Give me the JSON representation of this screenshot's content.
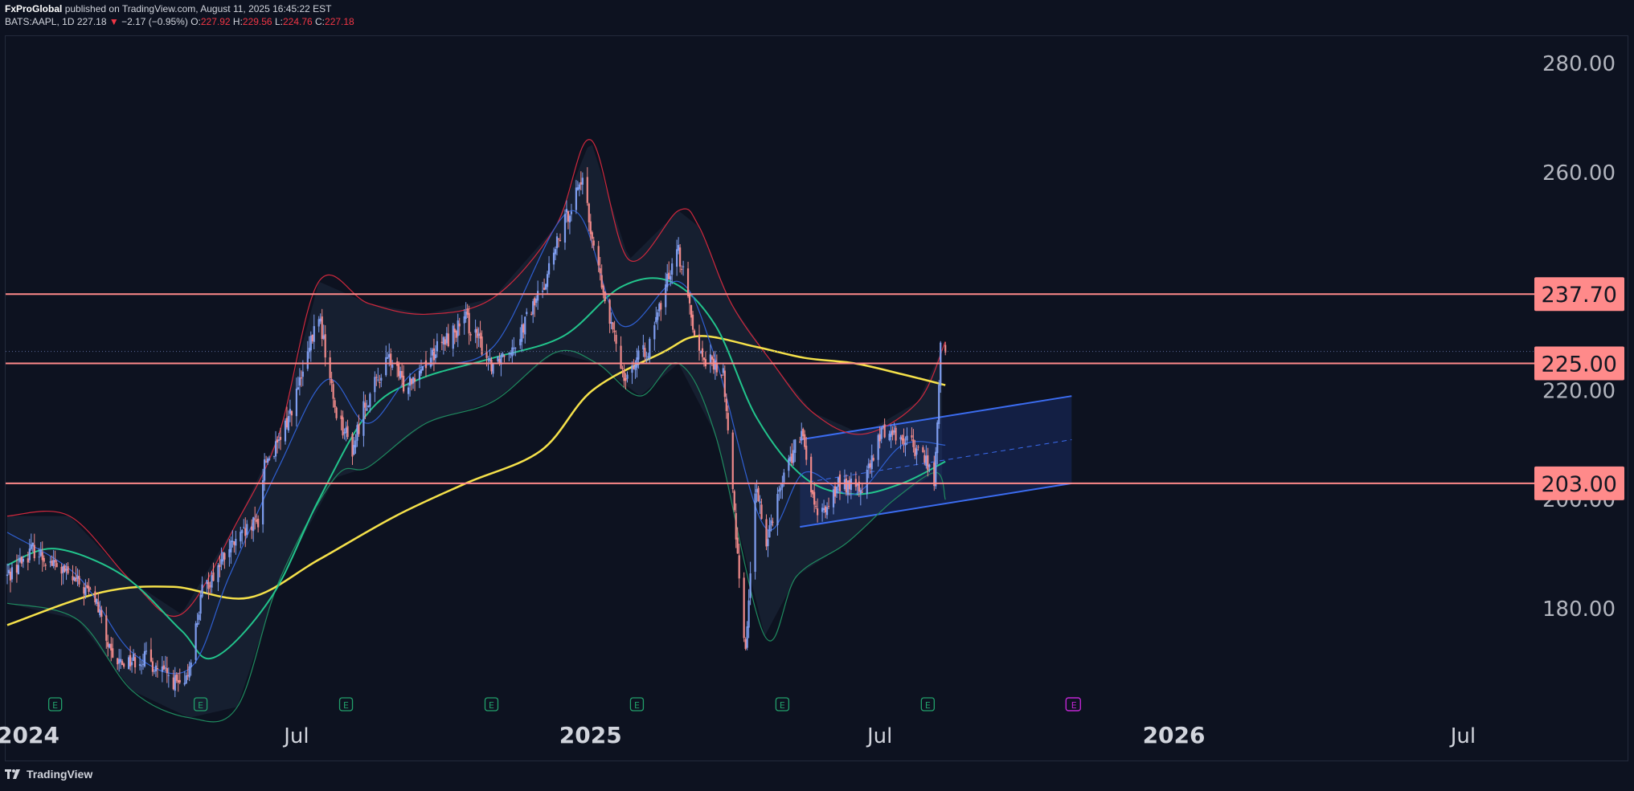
{
  "header": {
    "publisher": "FxProGlobal",
    "published_text": "published on TradingView.com, August 11, 2025 16:45:22 EST",
    "symbol": "BATS:AAPL, 1D",
    "last": "227.18",
    "change": "−2.17 (−0.95%)",
    "o_label": "O:",
    "o": "227.92",
    "h_label": "H:",
    "h": "229.56",
    "l_label": "L:",
    "l": "224.76",
    "c_label": "C:",
    "c": "227.18"
  },
  "footer": {
    "brand": "TradingView"
  },
  "colors": {
    "background": "#0d1220",
    "up_candle": "#7f9ef0",
    "down_candle": "#f08a8a",
    "level_line": "#ff8a8a",
    "level_label_bg": "#ff8a8a",
    "ma200": "#f5e14a",
    "ma50": "#22c48c",
    "ma20": "#2f5fd1",
    "bb_band": "#d0283d",
    "bb_lower": "#1f8a5f",
    "channel": "#3b6cf0",
    "earnings": "#22a06b",
    "future_earnings": "#c026d3"
  },
  "chart_data": {
    "type": "candlestick",
    "symbol": "BATS:AAPL",
    "timeframe": "1D",
    "ylim": [
      158,
      286
    ],
    "x_range": [
      "2024-01-01",
      "2026-08-10"
    ],
    "price_axis_ticks": [
      "280.00",
      "260.00",
      "220.00",
      "200.00",
      "180.00"
    ],
    "price_axis_tick_values": [
      280,
      260,
      220,
      200,
      180
    ],
    "time_axis_labels": [
      {
        "label": "2024",
        "date": "2024-01-01",
        "bold": true
      },
      {
        "label": "Jul",
        "date": "2024-07-01",
        "bold": false
      },
      {
        "label": "2025",
        "date": "2025-01-01",
        "bold": true
      },
      {
        "label": "Jul",
        "date": "2025-07-01",
        "bold": false
      },
      {
        "label": "2026",
        "date": "2026-01-01",
        "bold": true
      },
      {
        "label": "Jul",
        "date": "2026-07-01",
        "bold": false
      }
    ],
    "horizontal_levels": [
      {
        "value": 237.7,
        "label": "237.70"
      },
      {
        "value": 225.0,
        "label": "225.00"
      },
      {
        "value": 203.0,
        "label": "203.00"
      }
    ],
    "last_price": 227.18,
    "earnings_markers": [
      "2024-02-01",
      "2024-05-02",
      "2024-08-01",
      "2024-10-31",
      "2025-01-30",
      "2025-05-01",
      "2025-07-31"
    ],
    "future_earnings_marker": "2025-10-30",
    "earnings_label": "E",
    "close_anchors": [
      [
        "2024-01-02",
        186
      ],
      [
        "2024-01-18",
        191
      ],
      [
        "2024-02-05",
        187
      ],
      [
        "2024-02-26",
        182
      ],
      [
        "2024-03-08",
        170
      ],
      [
        "2024-03-28",
        171
      ],
      [
        "2024-04-18",
        166
      ],
      [
        "2024-04-22",
        165
      ],
      [
        "2024-05-03",
        183
      ],
      [
        "2024-05-20",
        191
      ],
      [
        "2024-06-07",
        196
      ],
      [
        "2024-06-11",
        207
      ],
      [
        "2024-06-20",
        210
      ],
      [
        "2024-07-05",
        223
      ],
      [
        "2024-07-15",
        234
      ],
      [
        "2024-07-25",
        217
      ],
      [
        "2024-08-05",
        209
      ],
      [
        "2024-08-12",
        217
      ],
      [
        "2024-08-28",
        226
      ],
      [
        "2024-09-06",
        221
      ],
      [
        "2024-09-25",
        227
      ],
      [
        "2024-10-15",
        233
      ],
      [
        "2024-10-31",
        225
      ],
      [
        "2024-11-15",
        229
      ],
      [
        "2024-12-02",
        239
      ],
      [
        "2024-12-16",
        251
      ],
      [
        "2024-12-26",
        259
      ],
      [
        "2025-01-10",
        236
      ],
      [
        "2025-01-22",
        223
      ],
      [
        "2025-02-07",
        228
      ],
      [
        "2025-02-24",
        247
      ],
      [
        "2025-03-10",
        227
      ],
      [
        "2025-03-25",
        223
      ],
      [
        "2025-04-08",
        172
      ],
      [
        "2025-04-14",
        202
      ],
      [
        "2025-04-21",
        193
      ],
      [
        "2025-05-02",
        205
      ],
      [
        "2025-05-13",
        212
      ],
      [
        "2025-05-23",
        196
      ],
      [
        "2025-06-06",
        203
      ],
      [
        "2025-06-20",
        202
      ],
      [
        "2025-07-03",
        213
      ],
      [
        "2025-07-18",
        211
      ],
      [
        "2025-07-31",
        207
      ],
      [
        "2025-08-04",
        203
      ],
      [
        "2025-08-06",
        213
      ],
      [
        "2025-08-08",
        229
      ],
      [
        "2025-08-11",
        227
      ]
    ],
    "moving_averages": [
      {
        "period": "200",
        "color": "#f5e14a",
        "points": [
          [
            "2024-01-02",
            177
          ],
          [
            "2024-03-01",
            183
          ],
          [
            "2024-04-15",
            184
          ],
          [
            "2024-06-01",
            182
          ],
          [
            "2024-07-15",
            189
          ],
          [
            "2024-09-01",
            197
          ],
          [
            "2024-10-15",
            203
          ],
          [
            "2024-12-01",
            209
          ],
          [
            "2025-01-02",
            220
          ],
          [
            "2025-02-15",
            227
          ],
          [
            "2025-03-10",
            230
          ],
          [
            "2025-04-15",
            228
          ],
          [
            "2025-05-15",
            226
          ],
          [
            "2025-06-15",
            225
          ],
          [
            "2025-07-15",
            223
          ],
          [
            "2025-08-11",
            221
          ]
        ]
      },
      {
        "period": "50",
        "color": "#22c48c",
        "points": [
          [
            "2024-01-02",
            188
          ],
          [
            "2024-02-01",
            191
          ],
          [
            "2024-03-15",
            186
          ],
          [
            "2024-04-20",
            176
          ],
          [
            "2024-05-10",
            171
          ],
          [
            "2024-06-15",
            182
          ],
          [
            "2024-07-15",
            200
          ],
          [
            "2024-08-15",
            216
          ],
          [
            "2024-09-15",
            222
          ],
          [
            "2024-11-01",
            226
          ],
          [
            "2024-12-15",
            230
          ],
          [
            "2025-01-20",
            239
          ],
          [
            "2025-02-20",
            240
          ],
          [
            "2025-03-20",
            232
          ],
          [
            "2025-04-15",
            215
          ],
          [
            "2025-05-15",
            204
          ],
          [
            "2025-06-15",
            201
          ],
          [
            "2025-07-15",
            203
          ],
          [
            "2025-08-11",
            207
          ]
        ]
      },
      {
        "period": "20",
        "color": "#2f5fd1",
        "points": [
          [
            "2024-01-02",
            194
          ],
          [
            "2024-02-15",
            186
          ],
          [
            "2024-03-20",
            172
          ],
          [
            "2024-04-25",
            169
          ],
          [
            "2024-05-20",
            186
          ],
          [
            "2024-06-20",
            206
          ],
          [
            "2024-07-20",
            222
          ],
          [
            "2024-08-15",
            214
          ],
          [
            "2024-09-15",
            224
          ],
          [
            "2024-11-01",
            228
          ],
          [
            "2024-12-20",
            253
          ],
          [
            "2025-01-20",
            232
          ],
          [
            "2025-02-25",
            240
          ],
          [
            "2025-03-20",
            226
          ],
          [
            "2025-04-20",
            195
          ],
          [
            "2025-05-15",
            205
          ],
          [
            "2025-06-15",
            201
          ],
          [
            "2025-07-15",
            210
          ],
          [
            "2025-08-11",
            210
          ]
        ]
      }
    ],
    "bollinger_upper": [
      [
        "2024-01-02",
        197
      ],
      [
        "2024-02-10",
        197
      ],
      [
        "2024-03-20",
        185
      ],
      [
        "2024-04-20",
        179
      ],
      [
        "2024-05-25",
        196
      ],
      [
        "2024-06-20",
        212
      ],
      [
        "2024-07-15",
        240
      ],
      [
        "2024-08-15",
        236
      ],
      [
        "2024-09-20",
        234
      ],
      [
        "2024-11-01",
        237
      ],
      [
        "2024-12-10",
        250
      ],
      [
        "2025-01-01",
        266
      ],
      [
        "2025-01-25",
        244
      ],
      [
        "2025-02-25",
        253
      ],
      [
        "2025-03-10",
        250
      ],
      [
        "2025-03-30",
        236
      ],
      [
        "2025-04-25",
        225
      ],
      [
        "2025-05-20",
        216
      ],
      [
        "2025-06-20",
        212
      ],
      [
        "2025-07-25",
        218
      ],
      [
        "2025-08-11",
        229
      ]
    ],
    "bollinger_lower": [
      [
        "2024-01-02",
        181
      ],
      [
        "2024-02-15",
        178
      ],
      [
        "2024-03-20",
        165
      ],
      [
        "2024-04-25",
        160
      ],
      [
        "2024-05-25",
        162
      ],
      [
        "2024-06-20",
        185
      ],
      [
        "2024-07-25",
        204
      ],
      [
        "2024-08-15",
        206
      ],
      [
        "2024-09-20",
        214
      ],
      [
        "2024-11-01",
        218
      ],
      [
        "2024-12-10",
        227
      ],
      [
        "2025-01-05",
        225
      ],
      [
        "2025-02-01",
        219
      ],
      [
        "2025-02-25",
        225
      ],
      [
        "2025-03-20",
        212
      ],
      [
        "2025-04-20",
        175
      ],
      [
        "2025-05-10",
        186
      ],
      [
        "2025-06-10",
        192
      ],
      [
        "2025-07-10",
        200
      ],
      [
        "2025-08-05",
        205
      ],
      [
        "2025-08-11",
        200
      ]
    ],
    "regression_channel": {
      "start": "2025-05-12",
      "end": "2025-10-29",
      "lower": [
        195,
        203
      ],
      "mid": [
        203,
        211
      ],
      "upper": [
        211,
        219
      ]
    }
  }
}
